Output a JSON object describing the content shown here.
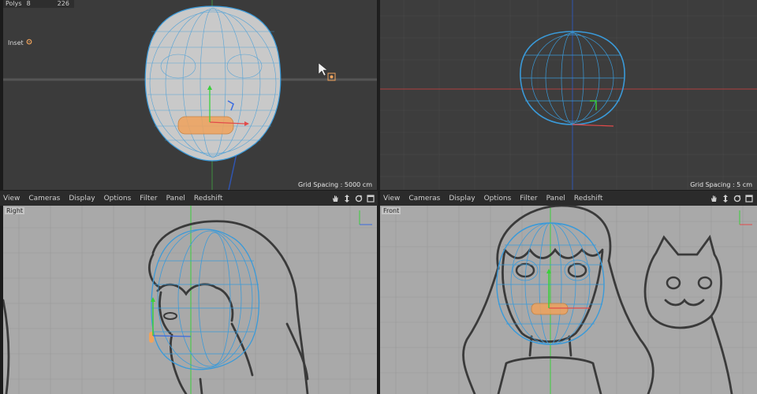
{
  "stats": {
    "label": "Polys",
    "selected": "8",
    "total": "226"
  },
  "tool": {
    "label": "Inset",
    "icon": "gear-icon"
  },
  "viewports": {
    "perspective": {
      "grid_spacing": "Grid Spacing : 5000 cm"
    },
    "top": {
      "grid_spacing": "Grid Spacing : 5 cm"
    },
    "right": {
      "name": "Right"
    },
    "front": {
      "name": "Front"
    }
  },
  "menubar": {
    "items": [
      "View",
      "Cameras",
      "Display",
      "Options",
      "Filter",
      "Panel",
      "Redshift"
    ],
    "icons": [
      "hand-icon",
      "move-vertical-icon",
      "rotate-icon",
      "maximize-icon"
    ]
  },
  "colors": {
    "dark_viewport": "#3b3b3b",
    "ortho_viewport": "#a9a9a9",
    "wire_blue": "#3a9ad9",
    "selection_orange": "#f0a35c",
    "axis_red": "#e24a4a",
    "axis_green": "#3ad03a",
    "axis_blue": "#3a6ae0"
  }
}
